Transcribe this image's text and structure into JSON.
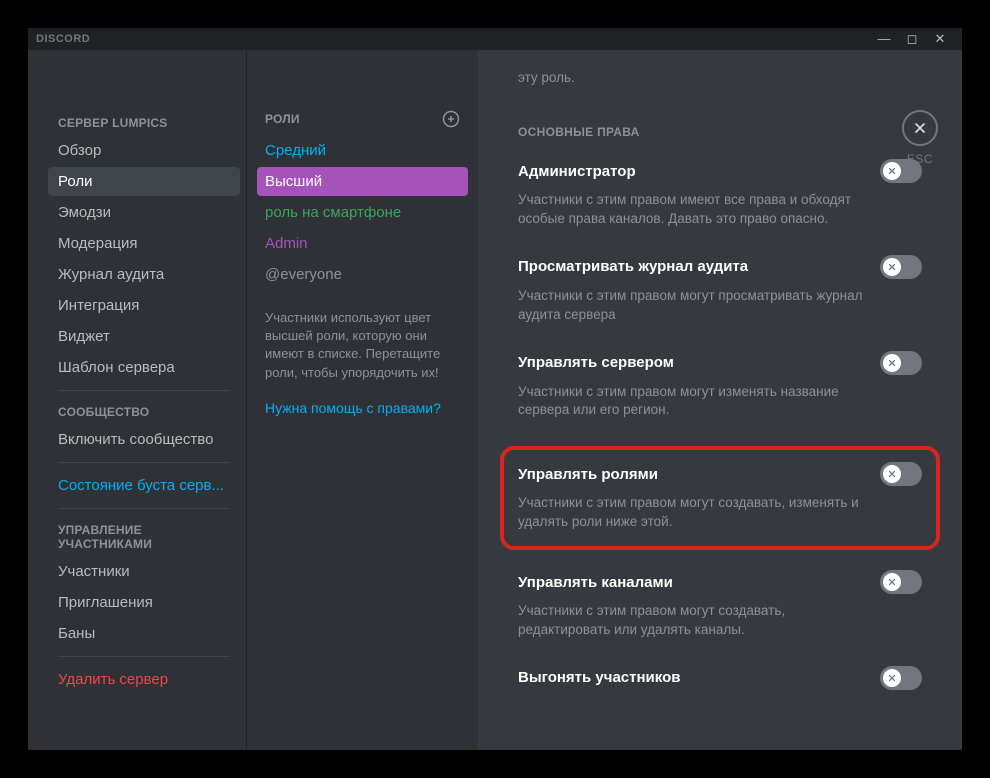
{
  "titlebar": {
    "brand": "DISCORD"
  },
  "close": {
    "esc": "ESC"
  },
  "sidebar": {
    "server_section": "СЕРВЕР LUMPICS",
    "items": [
      "Обзор",
      "Роли",
      "Эмодзи",
      "Модерация",
      "Журнал аудита",
      "Интеграция",
      "Виджет",
      "Шаблон сервера"
    ],
    "community_section": "СООБЩЕСТВО",
    "community_item": "Включить сообщество",
    "boost_status": "Состояние буста серв...",
    "members_section": "УПРАВЛЕНИЕ УЧАСТНИКАМИ",
    "members_items": [
      "Участники",
      "Приглашения",
      "Баны"
    ],
    "delete_server": "Удалить сервер"
  },
  "roles": {
    "header": "РОЛИ",
    "list": [
      {
        "name": "Средний",
        "color": "#00aff4"
      },
      {
        "name": "Высший",
        "color": "#ffffff",
        "selected": true
      },
      {
        "name": "роль на смартфоне",
        "color": "#3ba55d"
      },
      {
        "name": "Admin",
        "color": "#a652bb"
      },
      {
        "name": "@everyone",
        "color": "#8e9297"
      }
    ],
    "hint": "Участники используют цвет высшей роли, которую они имеют в списке. Перетащите роли, чтобы упорядочить их!",
    "help": "Нужна помощь с правами?"
  },
  "main": {
    "top_desc": "эту роль.",
    "section_title": "ОСНОВНЫЕ ПРАВА",
    "perms": [
      {
        "title": "Администратор",
        "desc": "Участники с этим правом имеют все права и обходят особые права каналов. Давать это право опасно.",
        "highlight": false
      },
      {
        "title": "Просматривать журнал аудита",
        "desc": "Участники с этим правом могут просматривать журнал аудита сервера",
        "highlight": false
      },
      {
        "title": "Управлять сервером",
        "desc": "Участники с этим правом могут изменять название сервера или его регион.",
        "highlight": false
      },
      {
        "title": "Управлять ролями",
        "desc": "Участники с этим правом могут создавать, изменять и удалять роли ниже этой.",
        "highlight": true
      },
      {
        "title": "Управлять каналами",
        "desc": "Участники с этим правом могут создавать, редактировать или удалять каналы.",
        "highlight": false
      },
      {
        "title": "Выгонять участников",
        "desc": "",
        "highlight": false
      }
    ]
  }
}
